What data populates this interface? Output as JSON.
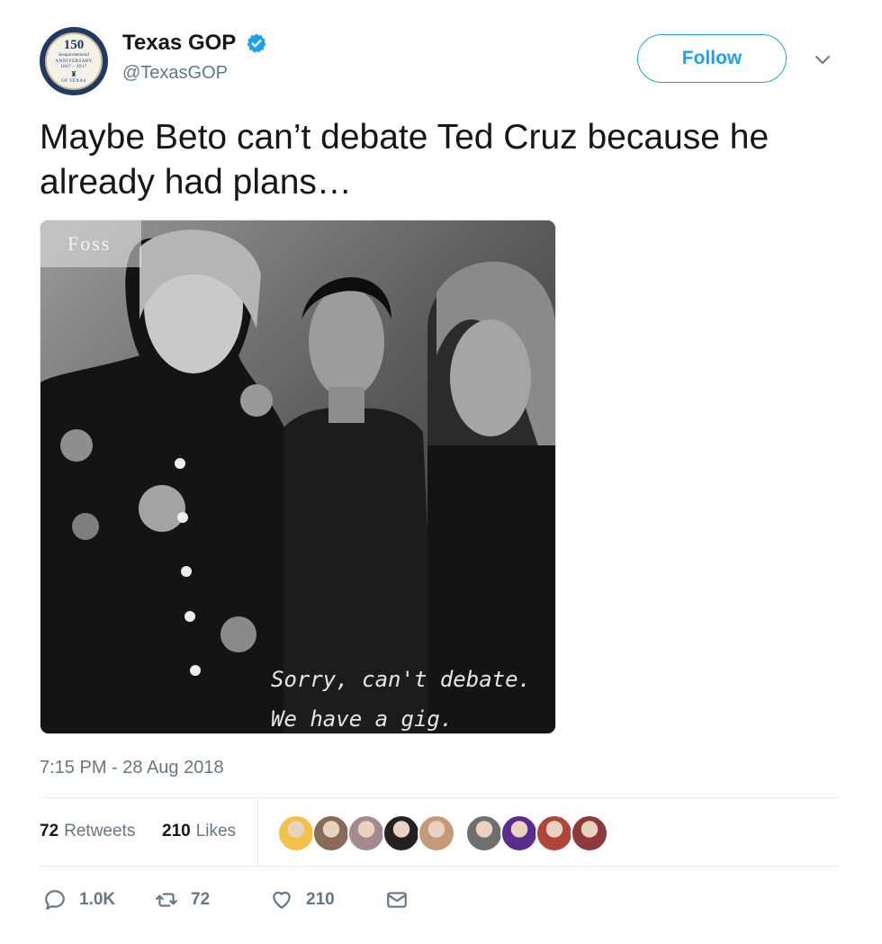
{
  "account": {
    "display_name": "Texas GOP",
    "handle": "@TexasGOP",
    "verified_icon": "verified-badge-icon",
    "avatar_seal": {
      "number": "150",
      "script": "Sesquicentennial",
      "anniversary": "ANNIVERSARY",
      "years": "1867 - 2017",
      "bottom": "OF TEXAS"
    }
  },
  "follow_button": {
    "label": "Follow"
  },
  "menu": {
    "icon": "chevron-down-icon"
  },
  "tweet": {
    "text": "Maybe Beto can’t debate Ted Cruz because he already had plans…",
    "media": {
      "corner_label": "Foss",
      "caption_line1": "Sorry, can't debate.",
      "caption_line2": "We have a gig."
    },
    "timestamp": "7:15 PM - 28 Aug 2018"
  },
  "stats": {
    "retweets_count": "72",
    "retweets_label": "Retweets",
    "likes_count": "210",
    "likes_label": "Likes"
  },
  "likers": [
    {
      "name": "liker-1",
      "color": "#f3c04a"
    },
    {
      "name": "liker-2",
      "color": "#8a6b55"
    },
    {
      "name": "liker-3",
      "color": "#a48a8e"
    },
    {
      "name": "liker-4",
      "color": "#222222"
    },
    {
      "name": "liker-5",
      "color": "#c49a7a"
    },
    {
      "name": "liker-6",
      "color": "#6f6f6f"
    },
    {
      "name": "liker-7",
      "color": "#5b2b8e"
    },
    {
      "name": "liker-8",
      "color": "#b0463a"
    },
    {
      "name": "liker-9",
      "color": "#8c3a3a"
    }
  ],
  "actions": {
    "reply": {
      "icon": "reply-icon",
      "count": "1.0K"
    },
    "retweet": {
      "icon": "retweet-icon",
      "count": "72"
    },
    "like": {
      "icon": "heart-icon",
      "count": "210"
    },
    "message": {
      "icon": "envelope-icon"
    }
  },
  "colors": {
    "accent": "#1da1f2",
    "secondary_text": "#657786",
    "primary_text": "#14171a",
    "divider": "#e6ecf0"
  }
}
